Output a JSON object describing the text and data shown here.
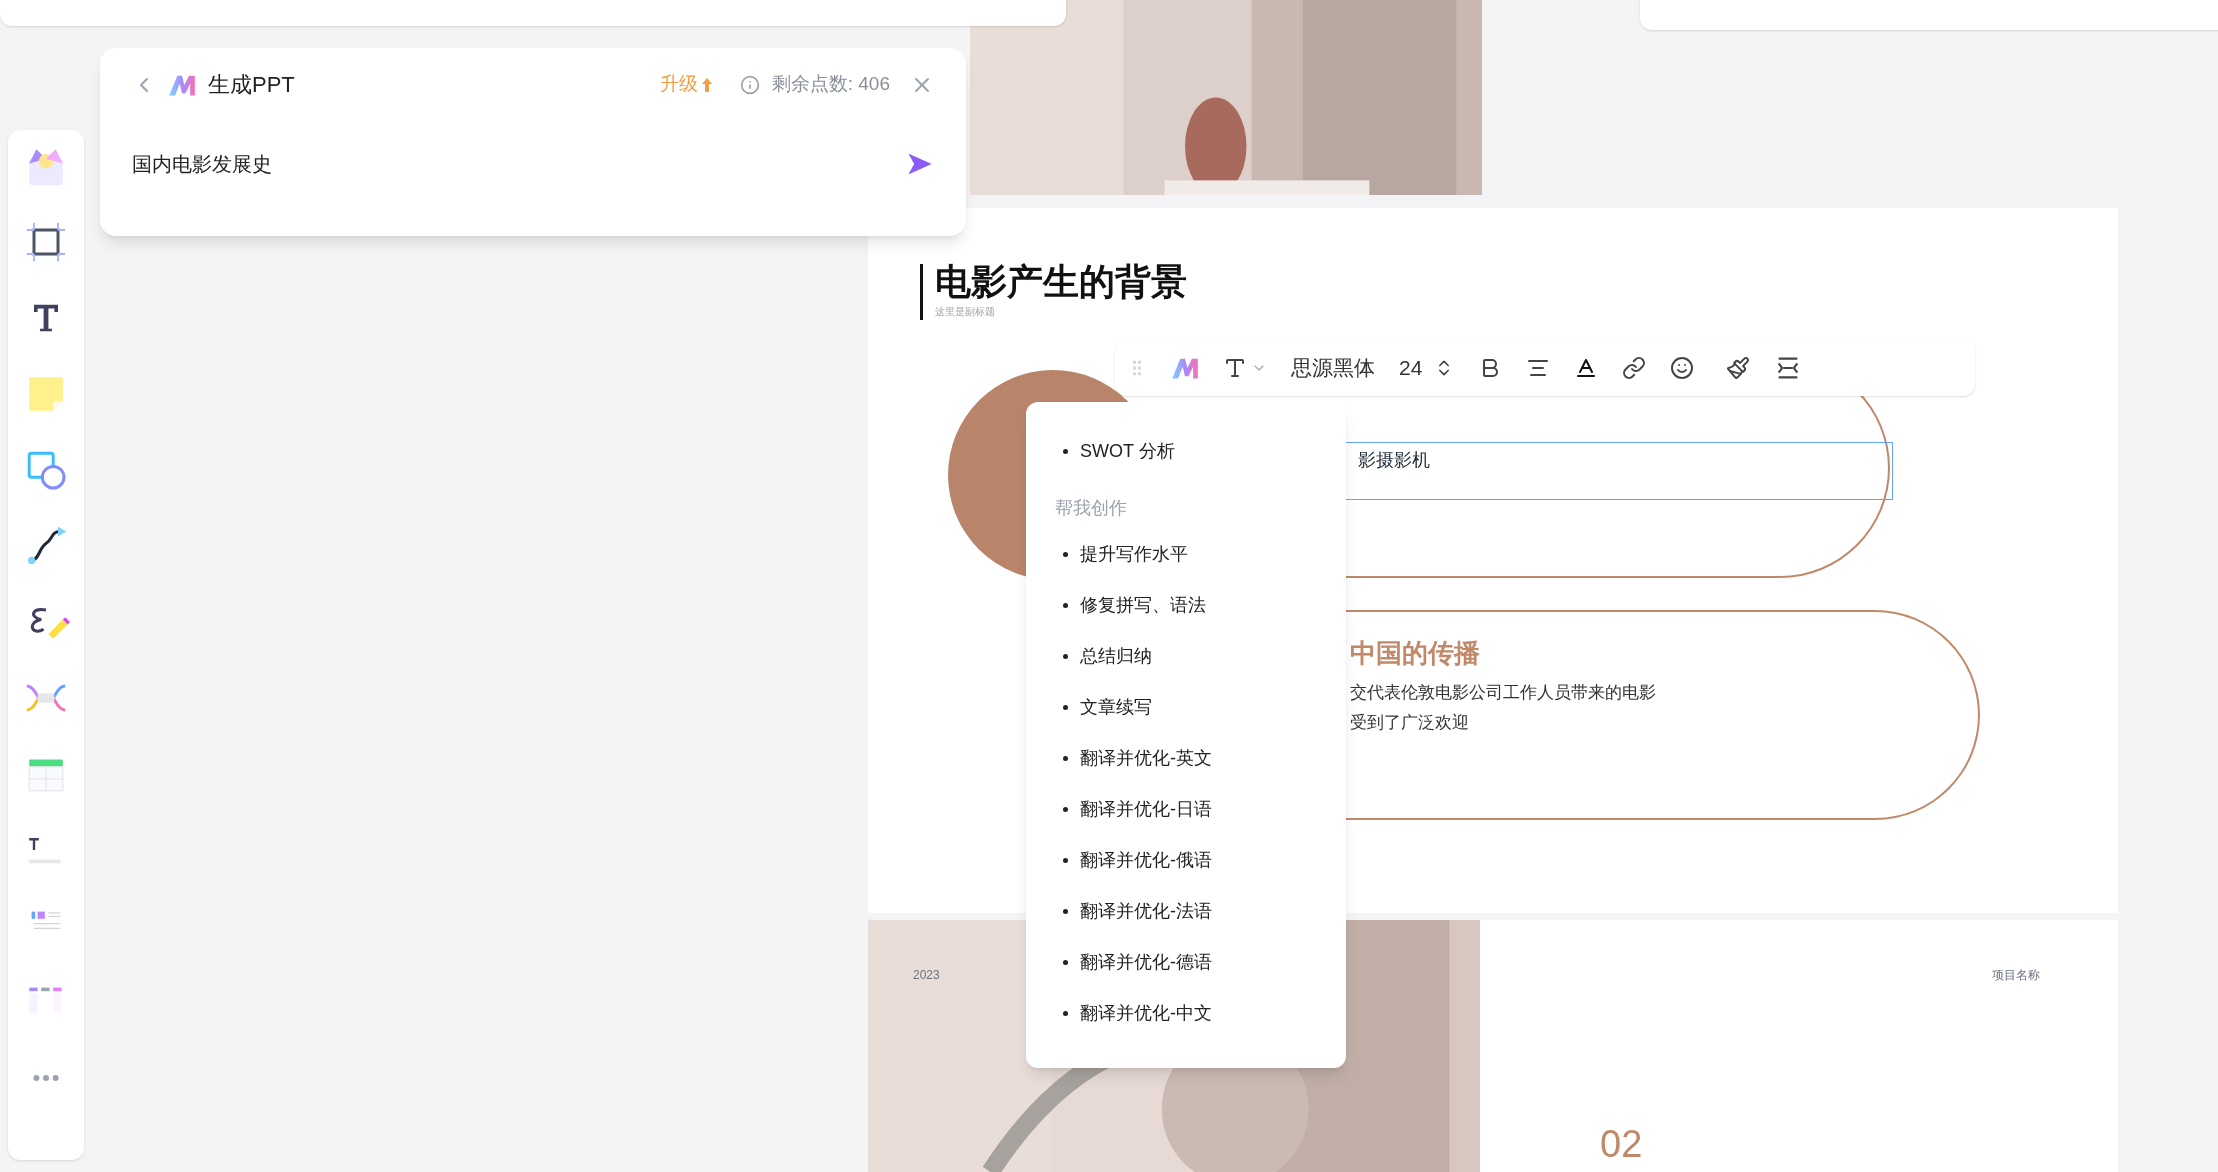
{
  "panel": {
    "title": "生成PPT",
    "upgrade": "升级",
    "points": "剩余点数: 406",
    "prompt": "国内电影发展史"
  },
  "slide": {
    "title": "电影产生的背景",
    "subtitle": "这里是副标题",
    "box_text": "影摄影机",
    "heading": "中国的传播",
    "body_lines": [
      "交代表伦敦电影公司工作人员带来的电影",
      "受到了广泛欢迎"
    ]
  },
  "toolbar": {
    "font": "思源黑体",
    "size": "24"
  },
  "menu": [
    {
      "kind": "item",
      "label": "SWOT 分析"
    },
    {
      "kind": "header",
      "label": "帮我创作"
    },
    {
      "kind": "item",
      "label": "提升写作水平"
    },
    {
      "kind": "item",
      "label": "修复拼写、语法"
    },
    {
      "kind": "item",
      "label": "总结归纳"
    },
    {
      "kind": "item",
      "label": "文章续写"
    },
    {
      "kind": "item",
      "label": "翻译并优化-英文"
    },
    {
      "kind": "item",
      "label": "翻译并优化-日语"
    },
    {
      "kind": "item",
      "label": "翻译并优化-俄语"
    },
    {
      "kind": "item",
      "label": "翻译并优化-法语"
    },
    {
      "kind": "item",
      "label": "翻译并优化-德语"
    },
    {
      "kind": "item",
      "label": "翻译并优化-中文"
    }
  ],
  "slide2": {
    "year": "2023",
    "project": "项目名称",
    "number": "02"
  }
}
